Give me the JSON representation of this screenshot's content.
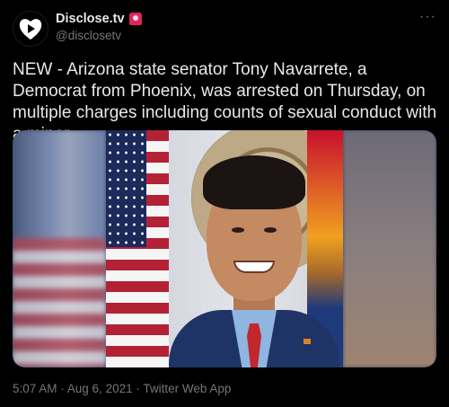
{
  "account": {
    "display_name": "Disclose.tv",
    "handle": "@disclosetv",
    "avatar_icon": "play-heart-logo-icon",
    "badge_icon": "siren-icon"
  },
  "tweet": {
    "text": "NEW - Arizona state senator Tony Navarrete, a Democrat from Phoenix, was arrested on Thursday, on multiple charges including counts of sexual conduct with a minor.",
    "more_icon": "more-options-icon",
    "timestamp": "5:07 AM · Aug 6, 2021 · Twitter Web App"
  },
  "colors": {
    "background": "#000000",
    "primary_text": "#e7e9ea",
    "secondary_text": "#71767b"
  }
}
